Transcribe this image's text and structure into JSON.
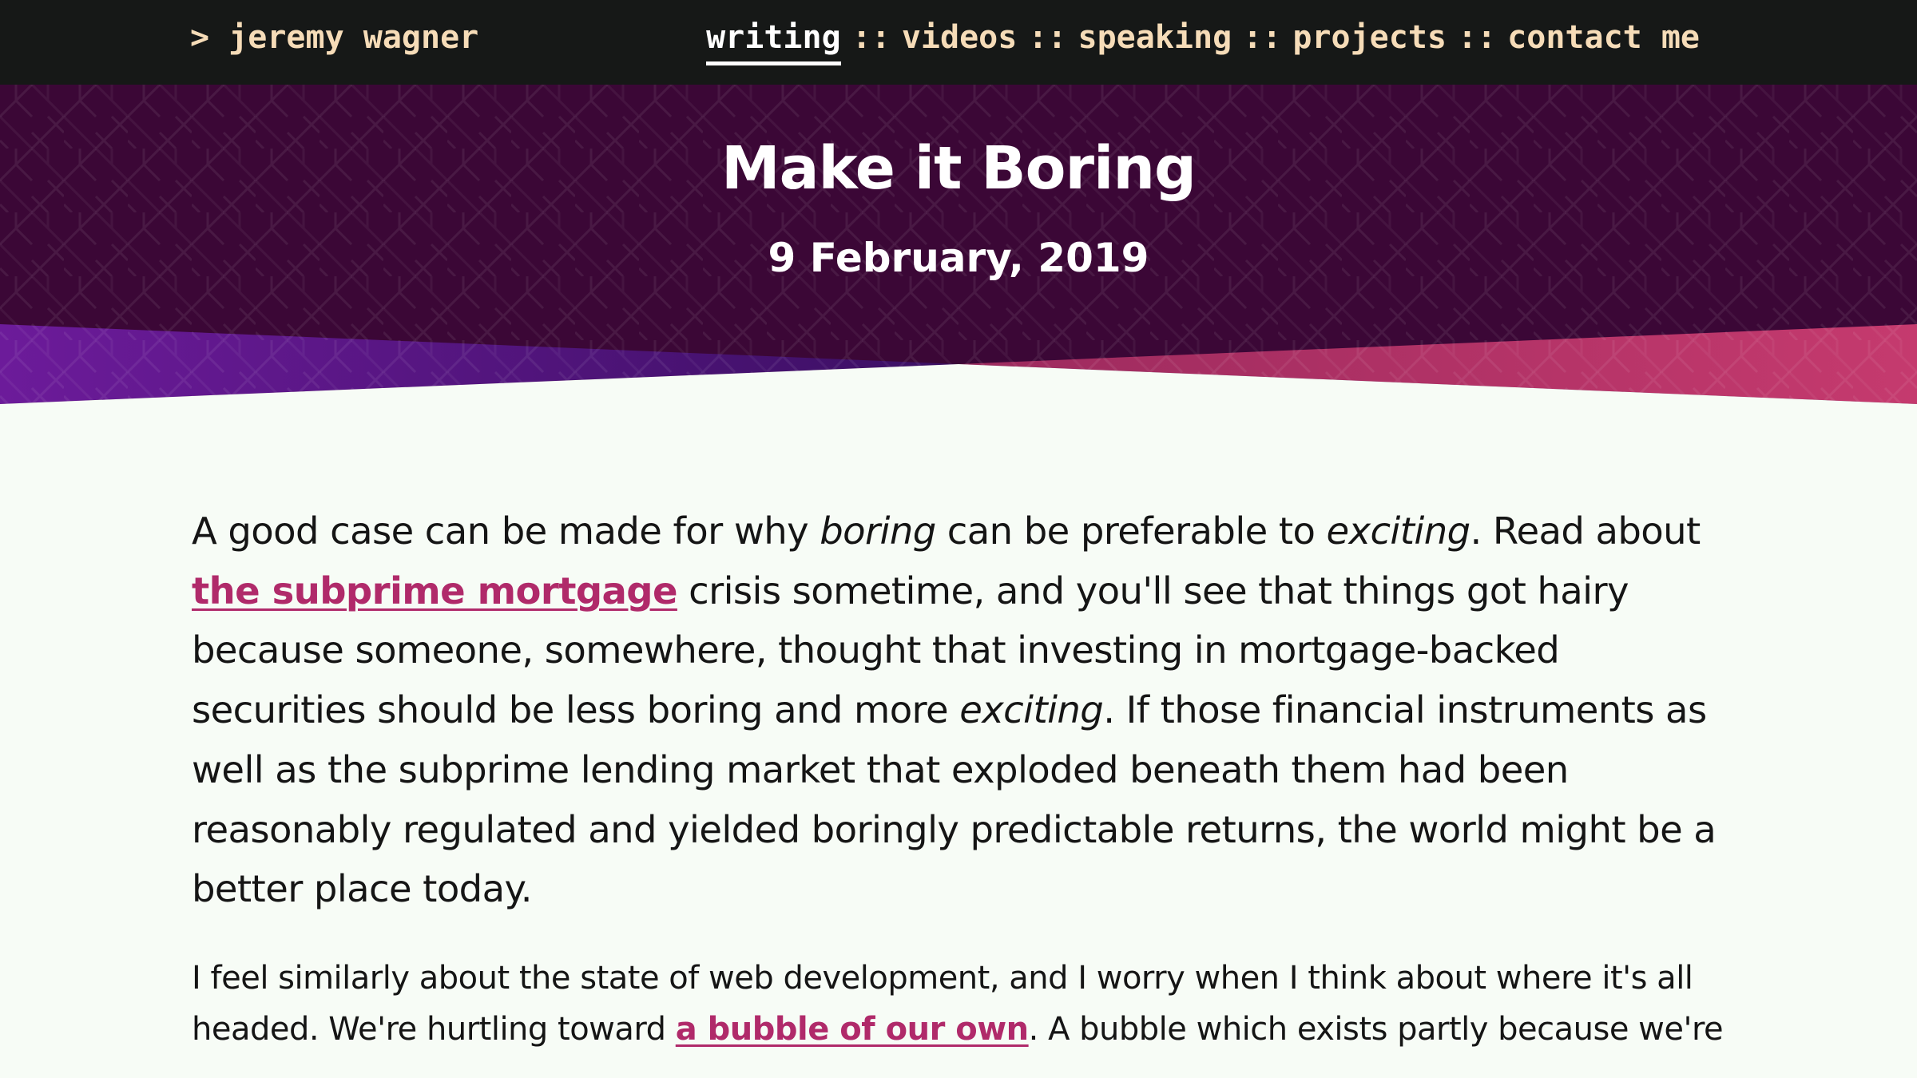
{
  "nav": {
    "brand": "> jeremy wagner",
    "separator": "::",
    "links": [
      {
        "label": "writing",
        "active": true
      },
      {
        "label": "videos",
        "active": false
      },
      {
        "label": "speaking",
        "active": false
      },
      {
        "label": "projects",
        "active": false
      },
      {
        "label": "contact me",
        "active": false
      }
    ]
  },
  "hero": {
    "title": "Make it Boring",
    "date": "9 February, 2019"
  },
  "article": {
    "p1": {
      "s1": "A good case can be made for why ",
      "em1": "boring",
      "s2": " can be preferable to ",
      "em2": "exciting",
      "s3": ". Read about ",
      "link": "the subprime mortgage",
      "s4": " crisis sometime, and you'll see that things got hairy because someone, somewhere, thought that investing in mortgage-backed securities should be less boring and more ",
      "em3": "exciting",
      "s5": ". If those financial instruments as well as the subprime lending market that exploded beneath them had been reasonably regulated and yielded boringly predictable returns, the world might be a better place today."
    },
    "p2": {
      "s1": "I feel similarly about the state of web development, and I worry when I think about where it's all headed. We're hurtling toward ",
      "link": "a bubble of our own",
      "s2": ". A bubble which exists partly because we're"
    }
  },
  "colors": {
    "nav_bg": "#161817",
    "nav_text": "#f6dcb8",
    "hero_bg": "#3b0736",
    "hero_purple": "#6c1b9a",
    "hero_pink": "#c0366b",
    "page_bg": "#f7fcf6",
    "link": "#b02a6a"
  }
}
